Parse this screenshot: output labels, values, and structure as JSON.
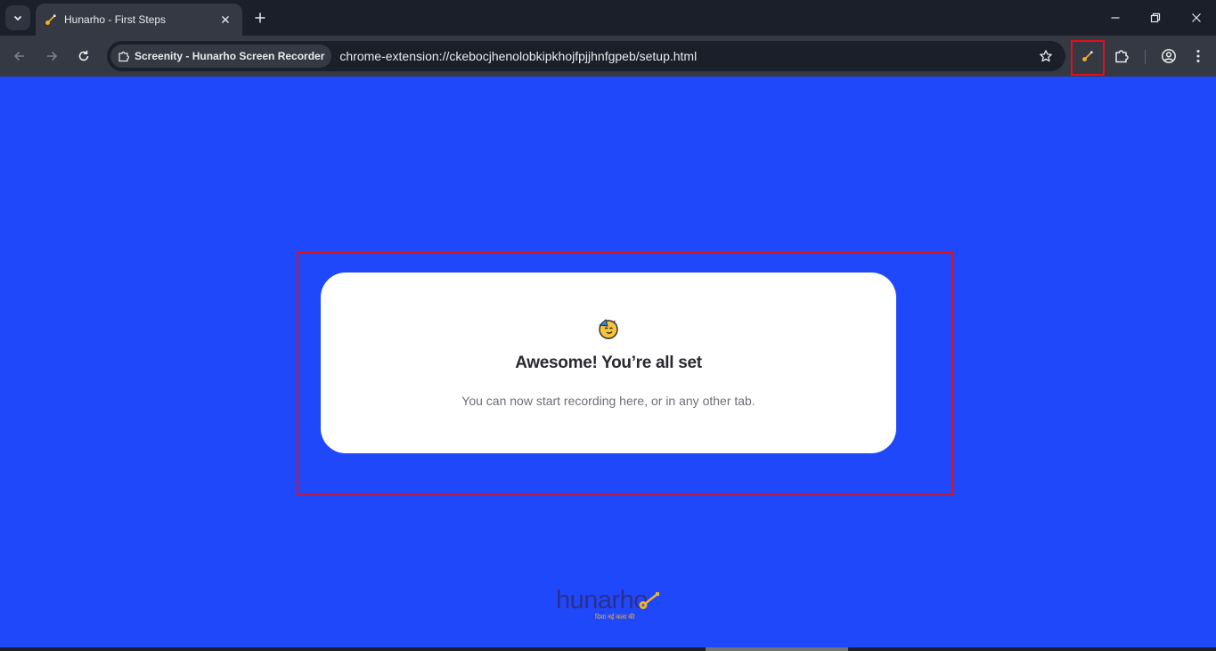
{
  "browser": {
    "tab": {
      "title": "Hunarho - First Steps"
    },
    "omnibox": {
      "site_label": "Screenity - Hunarho Screen Recorder",
      "url": "chrome-extension://ckebocjhenolobkipkhojfpjjhnfgpeb/setup.html"
    },
    "icons": {
      "tab_list": "chevron-down-icon",
      "new_tab": "plus-icon",
      "minimize": "minimize-icon",
      "restore": "restore-icon",
      "close": "close-icon",
      "back": "arrow-left-icon",
      "forward": "arrow-right-icon",
      "reload": "reload-icon",
      "extension_chip": "puzzle-icon",
      "bookmark": "star-icon",
      "hunarho_extension": "guitar-icon",
      "extensions_menu": "puzzle-icon",
      "profile": "profile-icon",
      "menu": "more-vertical-icon"
    }
  },
  "page": {
    "background_color": "#1f48fb",
    "card": {
      "emoji": "🥳",
      "title": "Awesome! You’re all set",
      "subtitle": "You can now start recording here, or in any other tab."
    },
    "logo": {
      "word": "hunarho",
      "tagline": "दिशा नई कला की"
    }
  },
  "colors": {
    "accent_highlight": "#e0101a",
    "brand_navy": "#2c2f8a",
    "brand_gold": "#f0b12c"
  }
}
